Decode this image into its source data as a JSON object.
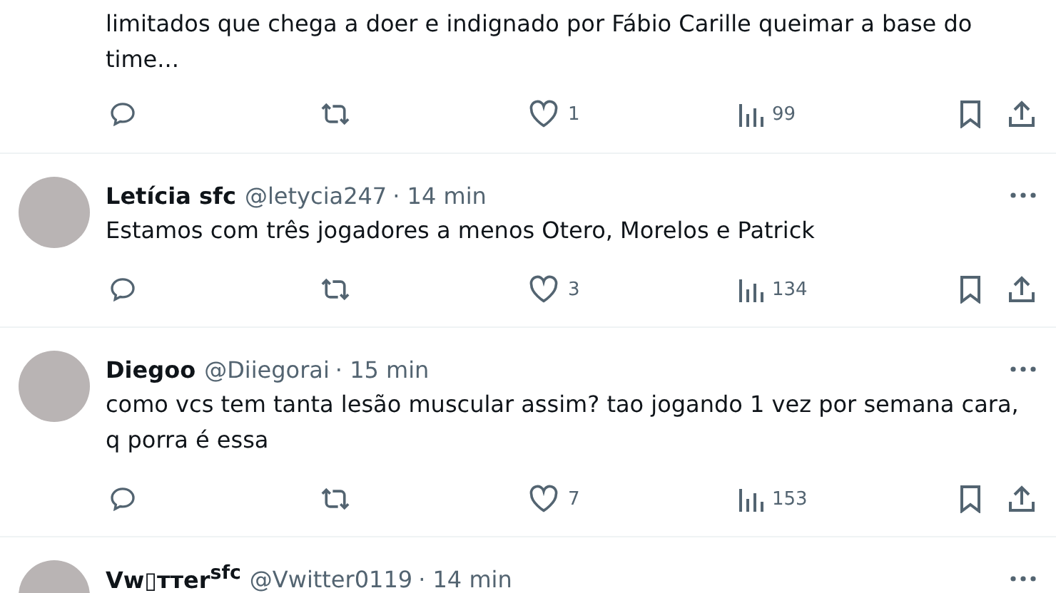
{
  "posts": [
    {
      "text": "limitados que chega a doer e indignado por Fábio Carille queimar a base do time...",
      "likes": "1",
      "views": "99"
    },
    {
      "author": "Letícia sfc",
      "handle": "@letycia247",
      "time": "· 14 min",
      "text": "Estamos com três jogadores a menos Otero, Morelos e Patrick",
      "likes": "3",
      "views": "134"
    },
    {
      "author": "Diegoo",
      "handle": "@Diiegorai",
      "time": "· 15 min",
      "text": "como vcs tem tanta lesão muscular assim? tao jogando 1 vez por semana cara, q porra é essa",
      "likes": "7",
      "views": "153"
    },
    {
      "author": "Vw▯ттеr$^{sfc}$",
      "handle": "@Vwitter0119",
      "time": "· 14 min"
    }
  ]
}
